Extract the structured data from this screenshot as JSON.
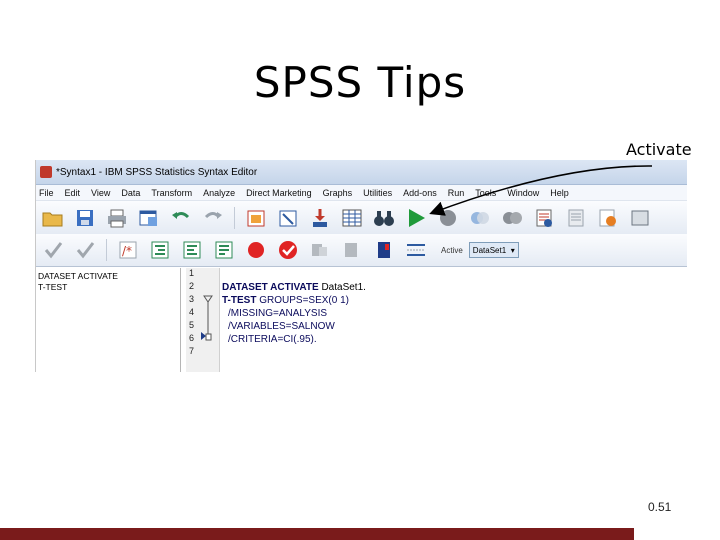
{
  "slide": {
    "title": "SPSS Tips",
    "callout": "Activate",
    "slide_number": "0.51"
  },
  "window": {
    "title": "*Syntax1 - IBM SPSS Statistics Syntax Editor"
  },
  "menu": [
    "File",
    "Edit",
    "View",
    "Data",
    "Transform",
    "Analyze",
    "Direct Marketing",
    "Graphs",
    "Utilities",
    "Add-ons",
    "Run",
    "Tools",
    "Window",
    "Help"
  ],
  "toolbar": {
    "active_label": "Active",
    "active_dataset": "DataSet1"
  },
  "navigator": [
    "DATASET ACTIVATE",
    "T-TEST"
  ],
  "line_numbers": [
    "1",
    "2",
    "3",
    "4",
    "5",
    "6",
    "7"
  ],
  "code": {
    "line2_kw": "DATASET ACTIVATE",
    "line2_rest": " DataSet1.",
    "line3_kw": "T-TEST",
    "line3_rest": " GROUPS=SEX(0 1)",
    "line4": "/MISSING=ANALYSIS",
    "line5": "/VARIABLES=SALNOW",
    "line6": "/CRITERIA=CI(.95)."
  },
  "colors": {
    "footer": "#7a1b1b",
    "run_button": "#1f9a3a",
    "keyword": "#0b0b5c"
  }
}
